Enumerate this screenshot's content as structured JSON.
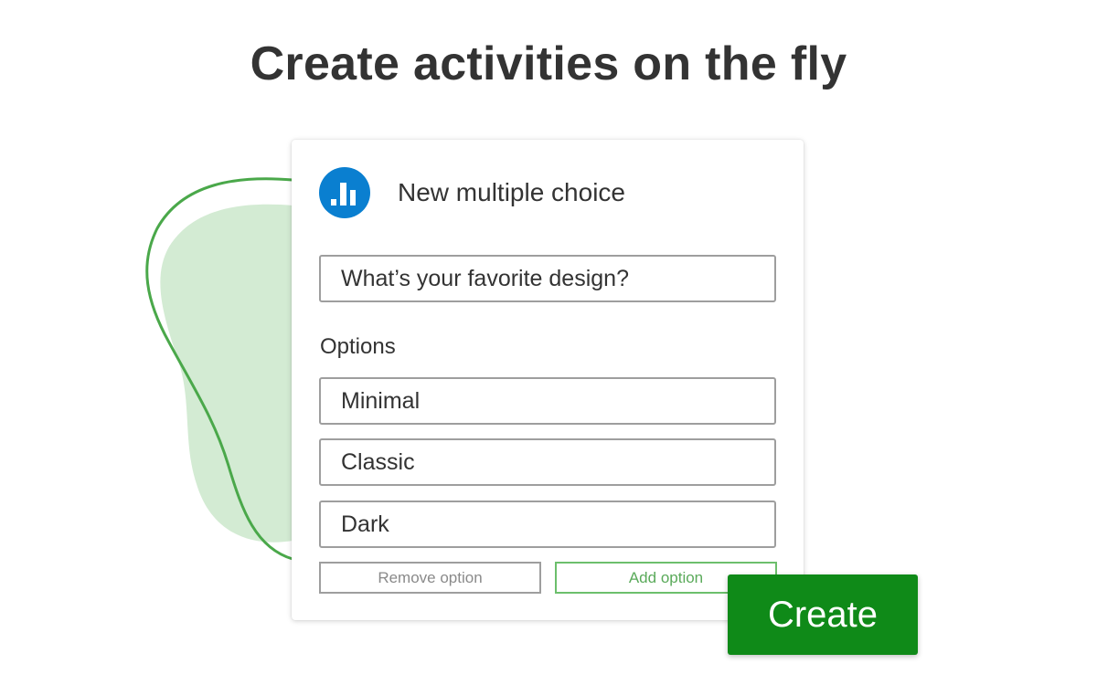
{
  "headline": "Create activities on the fly",
  "card": {
    "icon": "bar-chart-icon",
    "title": "New multiple choice",
    "question_value": "What’s your favorite design?",
    "options_label": "Options",
    "options": [
      "Minimal",
      "Classic",
      "Dark"
    ],
    "remove_label": "Remove option",
    "add_label": "Add option"
  },
  "create_label": "Create",
  "colors": {
    "brand_blue": "#0a7fd0",
    "create_green": "#0f8a18",
    "blob_fill": "#d3ebd3",
    "blob_outline": "#4aa84a",
    "add_green": "#5aaa5a",
    "text": "#333333"
  }
}
